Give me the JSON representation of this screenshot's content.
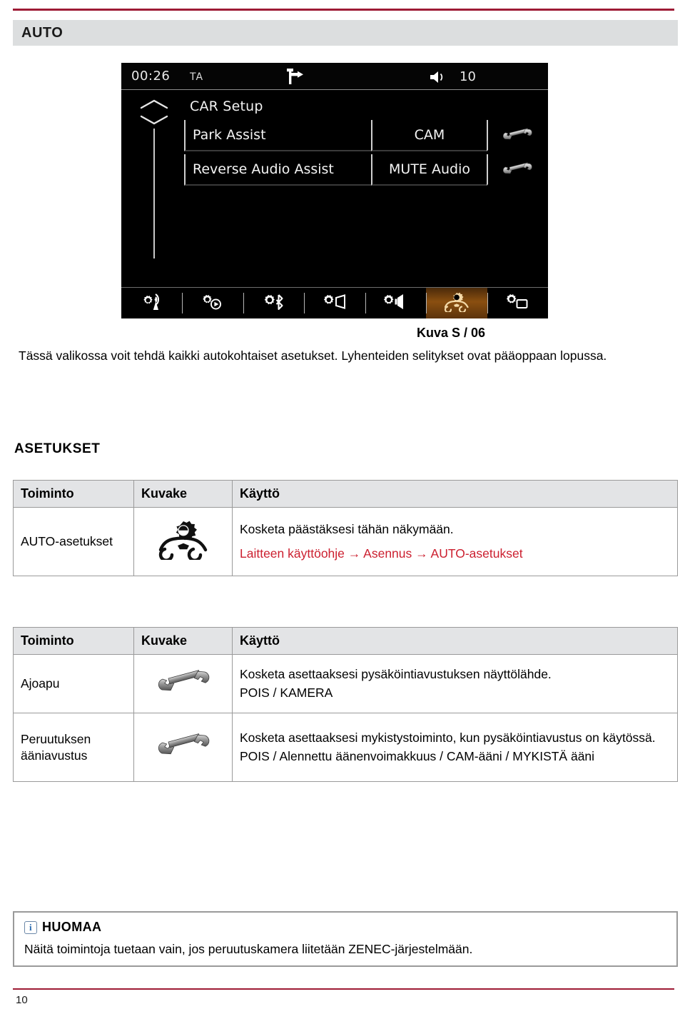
{
  "page": {
    "section_title": "AUTO",
    "page_number": "10",
    "accent_red": "#9e1b35",
    "link_red": "#cc2030",
    "header_bg": "#dcdedf"
  },
  "device": {
    "statusbar": {
      "time": "00:26",
      "ta_label": "TA",
      "nav_icon": "turn-right-signpost-icon",
      "volume_icon": "speaker-icon",
      "volume_value": "10"
    },
    "menu_title": "CAR Setup",
    "scroll": {
      "up_icon": "chevron-up-icon",
      "down_icon": "chevron-down-icon"
    },
    "menu_rows": [
      {
        "label": "Park Assist",
        "value": "CAM",
        "icon": "wrench-icon"
      },
      {
        "label": "Reverse Audio Assist",
        "value": "MUTE Audio",
        "icon": "wrench-icon"
      }
    ],
    "tabbar": [
      {
        "icon": "gear-radio-antenna-icon",
        "active": false
      },
      {
        "icon": "gear-media-play-icon",
        "active": false
      },
      {
        "icon": "gear-bluetooth-icon",
        "active": false
      },
      {
        "icon": "gear-display-icon",
        "active": false
      },
      {
        "icon": "gear-volume-icon",
        "active": false
      },
      {
        "icon": "gear-car-icon",
        "active": true
      },
      {
        "icon": "gear-screen-icon",
        "active": false
      }
    ]
  },
  "figure": {
    "caption": "Kuva S / 06",
    "description": "Tässä valikossa voit tehdä kaikki autokohtaiset asetukset. Lyhenteiden selitykset ovat pääoppaan lopussa."
  },
  "settings_heading": "ASETUKSET",
  "table_1": {
    "headers": [
      "Toiminto",
      "Kuvake",
      "Käyttö"
    ],
    "rows": [
      {
        "function": "AUTO-asetukset",
        "icon": "gear-car-icon",
        "use_line_1": "Kosketa päästäksesi tähän näkymään.",
        "use_line_2": "Laitteen käyttöohje → Asennus → AUTO-asetukset"
      }
    ]
  },
  "table_2": {
    "headers": [
      "Toiminto",
      "Kuvake",
      "Käyttö"
    ],
    "rows": [
      {
        "function": "Ajoapu",
        "icon": "wrench-icon",
        "use_line_1": "Kosketa asettaaksesi pysäköintiavustuksen näyttölähde.",
        "use_line_2": "POIS / KAMERA"
      },
      {
        "function": "Peruutuksen ääniavustus",
        "icon": "wrench-icon",
        "use_line_1": "Kosketa asettaaksesi mykistystoiminto, kun pysäköintiavustus on käytössä.",
        "use_line_2": "POIS / Alennettu äänenvoimakkuus / CAM-ääni / MYKISTÄ ääni"
      }
    ]
  },
  "note": {
    "icon": "info-icon",
    "title": "HUOMAA",
    "text": "Näitä toimintoja tuetaan vain, jos peruutuskamera liitetään ZENEC-järjestelmään."
  }
}
